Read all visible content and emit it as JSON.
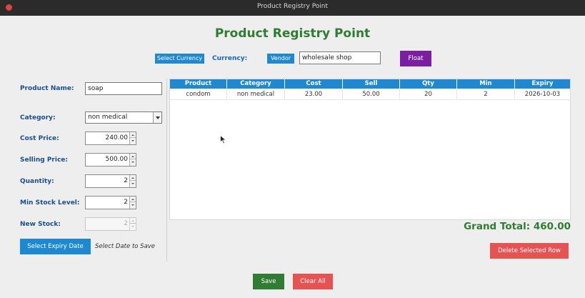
{
  "window": {
    "title": "Product Registry Point"
  },
  "heading": "Product Registry Point",
  "toolbar": {
    "select_currency": "Select Currency",
    "currency_label": "Currency:",
    "vendor_button": "Vendor",
    "vendor_value": "wholesale shop",
    "float_button": "Float"
  },
  "form": {
    "product_name_label": "Product Name:",
    "product_name_value": "soap",
    "category_label": "Category:",
    "category_value": "non medical",
    "cost_price_label": "Cost Price:",
    "cost_price_value": "240.00",
    "selling_price_label": "Selling Price:",
    "selling_price_value": "500.00",
    "quantity_label": "Quantity:",
    "quantity_value": "2",
    "min_stock_label": "Min Stock Level:",
    "min_stock_value": "2",
    "new_stock_label": "New Stock:",
    "new_stock_value": "2",
    "expiry_button": "Select Expiry Date",
    "expiry_hint": "Select Date to Save"
  },
  "table": {
    "columns": [
      "Product",
      "Category",
      "Cost",
      "Sell",
      "Qty",
      "Min",
      "Expiry"
    ],
    "rows": [
      [
        "condom",
        "non medical",
        "23.00",
        "50.00",
        "20",
        "2",
        "2026-10-03"
      ]
    ]
  },
  "grand_total": "Grand Total: 460.00",
  "actions": {
    "delete_row": "Delete Selected Row",
    "save": "Save",
    "clear_all": "Clear All"
  },
  "colors": {
    "accent_blue": "#1e88d0",
    "title_green": "#2e7d32",
    "danger_red": "#e55353",
    "float_purple": "#7b1fa2"
  }
}
